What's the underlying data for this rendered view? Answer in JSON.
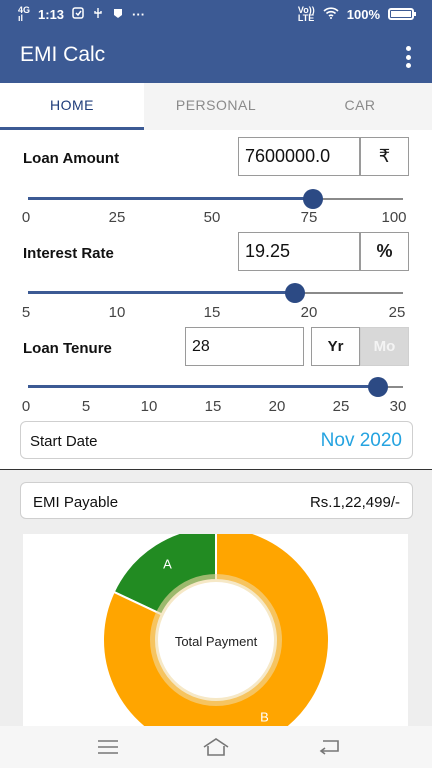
{
  "status": {
    "time": "1:13",
    "network_top": "4G",
    "network_bottom": "ıl",
    "volte_top": "Vo))",
    "volte_bottom": "LTE",
    "battery": "100%",
    "battery_level": 1.0
  },
  "appbar": {
    "title": "EMI Calc"
  },
  "tabs": [
    {
      "label": "HOME",
      "active": true
    },
    {
      "label": "PERSONAL",
      "active": false
    },
    {
      "label": "CAR",
      "active": false
    }
  ],
  "loan_amount": {
    "label": "Loan Amount",
    "value": "7600000.0",
    "unit": "₹",
    "slider_value": 76,
    "slider_max": 100,
    "ticks": [
      "0",
      "25",
      "50",
      "75",
      "100"
    ]
  },
  "interest_rate": {
    "label": "Interest Rate",
    "value": "19.25",
    "unit": "%",
    "slider_value": 19.25,
    "slider_min": 5,
    "slider_max": 25,
    "ticks": [
      "5",
      "10",
      "15",
      "20",
      "25"
    ]
  },
  "loan_tenure": {
    "label": "Loan Tenure",
    "value": "28",
    "unit_year": "Yr",
    "unit_month": "Mo",
    "slider_value": 28,
    "slider_max": 30,
    "ticks": [
      "0",
      "5",
      "10",
      "15",
      "20",
      "25",
      "30"
    ]
  },
  "start_date": {
    "label": "Start Date",
    "value": "Nov 2020"
  },
  "emi": {
    "label": "EMI Payable",
    "value": "Rs.1,22,499/-"
  },
  "chart_data": {
    "type": "pie",
    "center_label": "Total Payment",
    "slices": [
      {
        "label": "A",
        "fraction": 0.18,
        "color": "#228b22"
      },
      {
        "label": "B",
        "fraction": 0.82,
        "color": "#ffa500"
      }
    ]
  },
  "navbar": {
    "buttons": [
      {
        "name": "menu-icon"
      },
      {
        "name": "home-icon"
      },
      {
        "name": "back-icon"
      }
    ]
  }
}
